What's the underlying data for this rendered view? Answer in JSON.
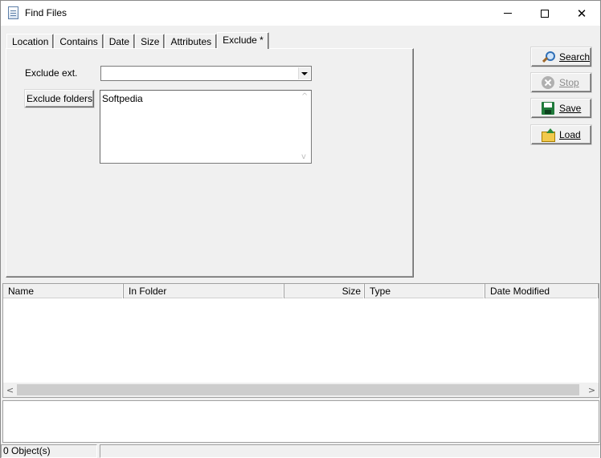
{
  "window": {
    "title": "Find Files",
    "icon": "document-icon"
  },
  "title_controls": {
    "minimize": "minimize-icon",
    "maximize": "maximize-icon",
    "close": "close-icon",
    "close_glyph": "✕"
  },
  "tabs": [
    {
      "label": "Location"
    },
    {
      "label": "Contains"
    },
    {
      "label": "Date"
    },
    {
      "label": "Size"
    },
    {
      "label": "Attributes"
    },
    {
      "label": "Exclude *",
      "active": true
    }
  ],
  "exclude_panel": {
    "exclude_ext_label": "Exclude ext.",
    "exclude_ext_value": "",
    "exclude_folders_button": "Exclude folders",
    "exclude_folders_text": "Softpedia"
  },
  "actions": {
    "search": {
      "label": "Search",
      "icon": "search-icon",
      "enabled": true
    },
    "stop": {
      "label": "Stop",
      "icon": "stop-icon",
      "enabled": false
    },
    "save": {
      "label": "Save",
      "icon": "save-icon",
      "enabled": true
    },
    "load": {
      "label": "Load",
      "icon": "load-icon",
      "enabled": true
    }
  },
  "results": {
    "columns": [
      "Name",
      "In Folder",
      "Size",
      "Type",
      "Date Modified"
    ],
    "rows": []
  },
  "scroll_arrows": {
    "left": "<",
    "right": ">",
    "up": "^",
    "down": "v"
  },
  "status": {
    "objects": "0 Object(s)",
    "secondary": ""
  }
}
